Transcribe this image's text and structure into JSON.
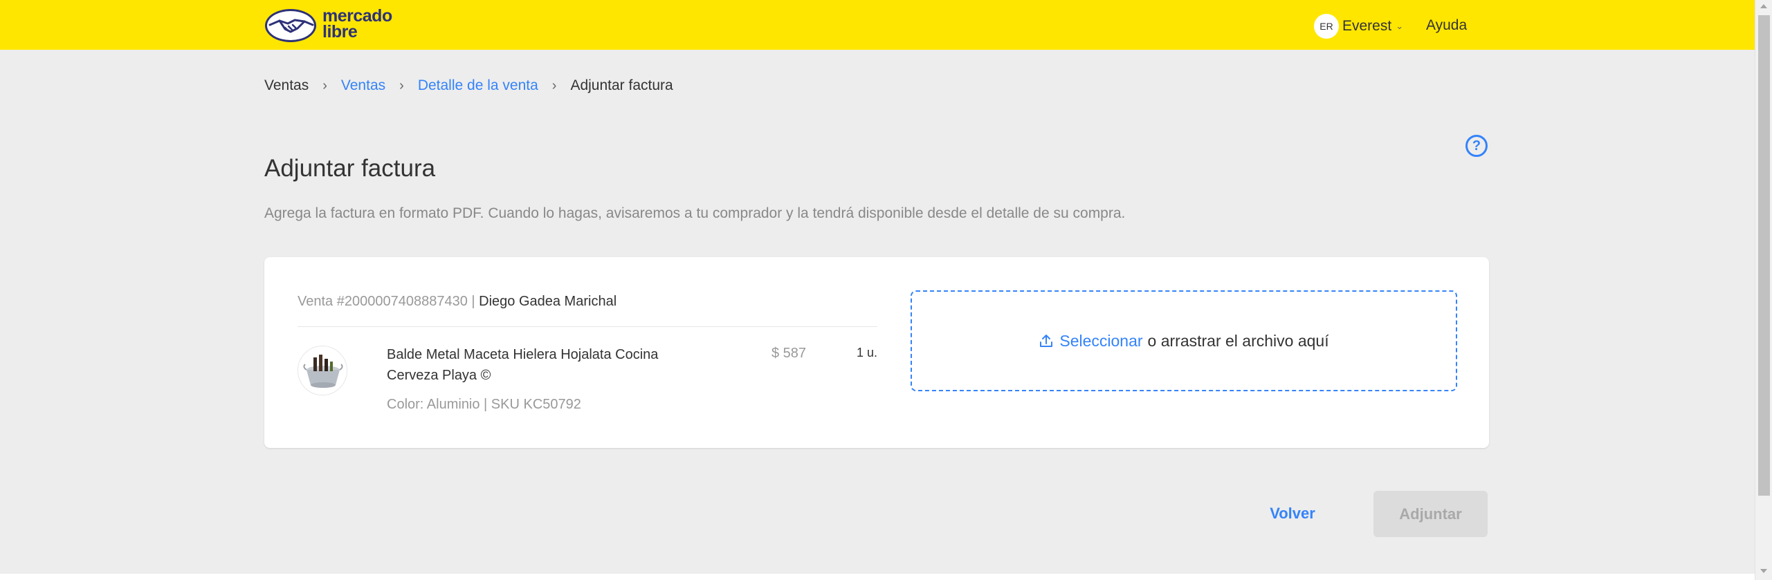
{
  "header": {
    "logo_text_line1": "mercado",
    "logo_text_line2": "libre",
    "user_initials": "ER",
    "user_name": "Everest",
    "help_label": "Ayuda"
  },
  "breadcrumb": {
    "items": [
      {
        "label": "Ventas"
      },
      {
        "label": "Ventas"
      },
      {
        "label": "Detalle de la venta"
      },
      {
        "label": "Adjuntar factura"
      }
    ]
  },
  "page": {
    "title": "Adjuntar factura",
    "subtitle": "Agrega la factura en formato PDF. Cuando lo hagas, avisaremos a tu comprador y la tendrá disponible desde el detalle de su compra."
  },
  "sale": {
    "id_label": "Venta #2000007408887430",
    "separator": "|",
    "buyer": "Diego Gadea Marichal",
    "product": {
      "title": "Balde Metal Maceta Hielera Hojalata Cocina Cerveza Playa ©",
      "meta": "Color: Aluminio | SKU KC50792",
      "price": "$ 587",
      "quantity": "1 u."
    }
  },
  "upload": {
    "select_label": "Seleccionar",
    "rest_label": "o arrastrar el archivo aquí"
  },
  "actions": {
    "back_label": "Volver",
    "submit_label": "Adjuntar"
  },
  "colors": {
    "brand_yellow": "#ffe600",
    "link_blue": "#3483fa",
    "background": "#ededed"
  }
}
